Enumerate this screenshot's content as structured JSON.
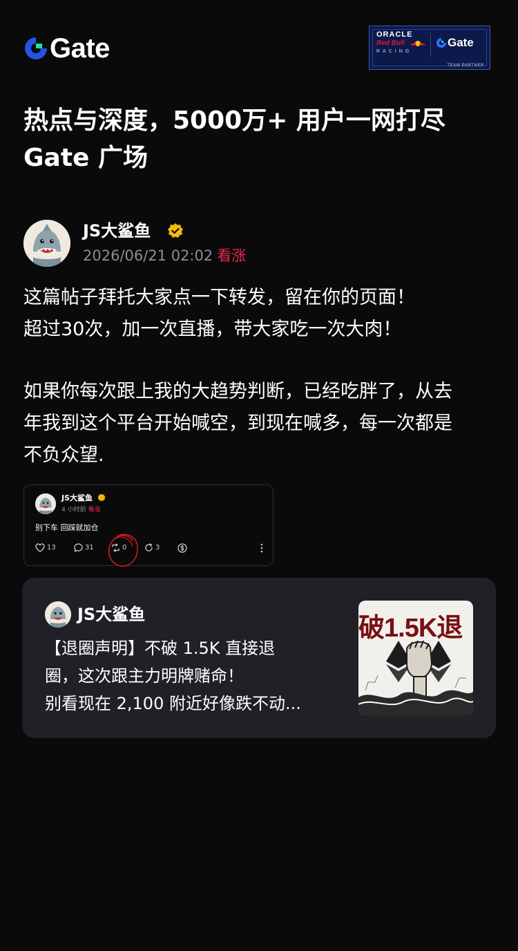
{
  "header": {
    "brand": "Gate",
    "partner": {
      "oracle": "ORACLE",
      "redbull": "Red Bull",
      "racing": "RACING",
      "brand": "Gate",
      "team_partner": "TEAM PARTNER"
    }
  },
  "headline": {
    "line1": "热点与深度，5000万+ 用户一网打尽",
    "line2": "Gate 广场"
  },
  "post": {
    "author": "JS大鲨鱼",
    "time": "2026/06/21 02:02",
    "tag": "看涨",
    "body": {
      "line1": "这篇帖子拜托大家点一下转发，留在你的页面！",
      "line2": "超过30次，加一次直播，带大家吃一次大肉！",
      "line3": "如果你每次跟上我的大趋势判断，已经吃胖了，从去",
      "line4": "年我到这个平台开始喊空，到现在喊多，每一次都是",
      "line5": "不负众望."
    }
  },
  "embed": {
    "author": "JS大鲨鱼",
    "time": "4 小时前",
    "tag": "看涨",
    "text": "别下车 回踩就加仓",
    "likes": "13",
    "comments": "31",
    "reposts": "0",
    "shares": "3"
  },
  "quote": {
    "author": "JS大鲨鱼",
    "line1": "【退圈声明】不破 1.5K 直接退",
    "line2": "圈，这次跟主力明牌赌命！",
    "line3": "别看现在 2,100 附近好像跌不动...",
    "thumb_title": "破1.5K退"
  },
  "colors": {
    "background": "#0a0a0b",
    "brand_blue": "#2354e6",
    "brand_green": "#17e5a1",
    "bullish_red": "#e8294b",
    "card_bg": "#1f2126",
    "muted_text": "#8b8f98",
    "verified_gold": "#f0b90b"
  }
}
